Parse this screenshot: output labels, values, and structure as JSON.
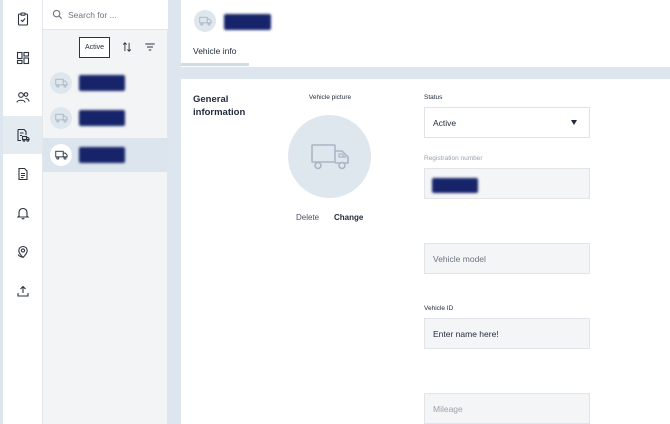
{
  "nav": {
    "items": [
      {
        "icon": "clipboard-check-icon"
      },
      {
        "icon": "dashboard-grid-icon"
      },
      {
        "icon": "users-icon"
      },
      {
        "icon": "vehicle-document-icon",
        "active": true
      },
      {
        "icon": "document-icon"
      },
      {
        "icon": "bell-icon"
      },
      {
        "icon": "location-pin-icon"
      },
      {
        "icon": "upload-icon"
      }
    ]
  },
  "list": {
    "search_placeholder": "Search for ...",
    "filter_chip": "Active"
  },
  "vehicle_info": {
    "tab_label": "Vehicle info",
    "section_title": "General information",
    "picture_label": "Vehicle picture",
    "delete_label": "Delete",
    "change_label": "Change",
    "status_label": "Status",
    "status_value": "Active",
    "registration_label": "Registration number",
    "vehicle_model_placeholder": "Vehicle model",
    "vehicle_id_label": "Vehicle ID",
    "vehicle_id_placeholder": "Enter name here!",
    "mileage_placeholder": "Mileage"
  },
  "colors": {
    "accent_navy": "#17246a",
    "panel_blue": "#dde6ee",
    "selected_row": "#dce5ed"
  }
}
